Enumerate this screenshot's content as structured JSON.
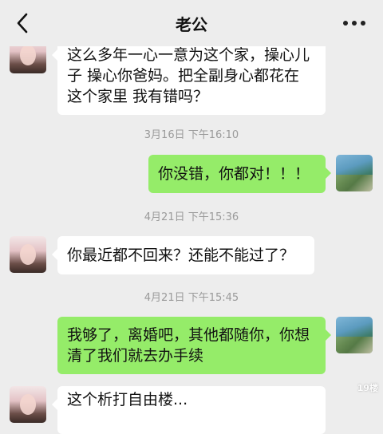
{
  "header": {
    "title": "老公",
    "back_icon": "chevron-left-icon",
    "more_icon": "more-dots-icon"
  },
  "messages": [
    {
      "side": "left",
      "avatar": "avatar-girl",
      "text": "这么多年一心一意为这个家，操心儿子 操心你爸妈。把全副身心都花在这个家里 我有错吗？"
    },
    {
      "type": "timestamp",
      "text": "3月16日 下午16:10"
    },
    {
      "side": "right",
      "avatar": "avatar-sea",
      "text": "你没错，你都对！！！"
    },
    {
      "type": "timestamp",
      "text": "4月21日 下午15:36"
    },
    {
      "side": "left",
      "avatar": "avatar-girl",
      "text": "你最近都不回来？还能不能过了？"
    },
    {
      "type": "timestamp",
      "text": "4月21日 下午15:45"
    },
    {
      "side": "right",
      "avatar": "avatar-sea",
      "text": "我够了，离婚吧，其他都随你，你想清了我们就去办手续"
    },
    {
      "side": "left",
      "avatar": "avatar-girl",
      "text": "这个析打自由楼..."
    }
  ],
  "watermark": "19楼",
  "colors": {
    "background": "#ededed",
    "bubble_white": "#ffffff",
    "bubble_green": "#95ec69",
    "timestamp": "#9a9a9a"
  }
}
